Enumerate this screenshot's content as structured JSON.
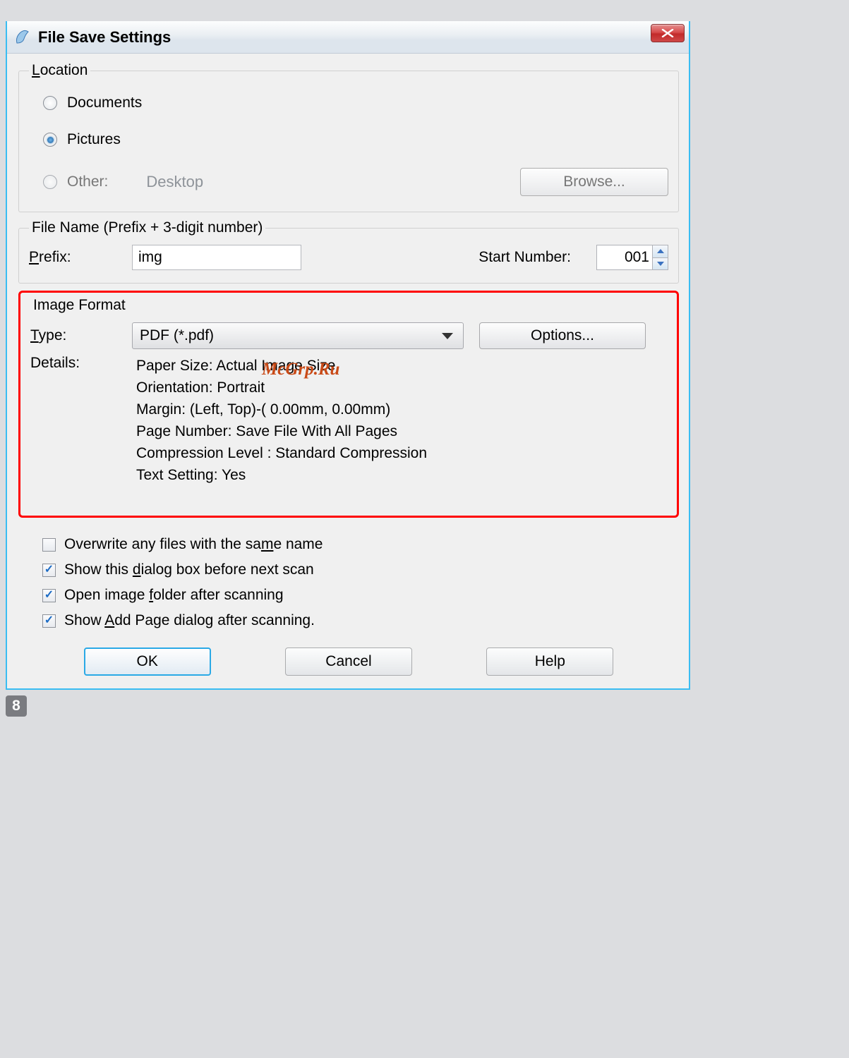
{
  "window": {
    "title": "File Save Settings"
  },
  "location": {
    "legend_pre": "L",
    "legend_rest": "ocation",
    "documents": "Documents",
    "pictures": "Pictures",
    "other": "Other:",
    "other_value": "Desktop",
    "browse_pre": "B",
    "browse_rest": "rowse..."
  },
  "filename": {
    "legend": "File Name (Prefix + 3-digit number)",
    "prefix_pre": "P",
    "prefix_rest": "refix:",
    "prefix_value": "img",
    "start_pre": "Start ",
    "start_ul": "N",
    "start_post": "umber:",
    "start_value": "001"
  },
  "image_format": {
    "legend": "Image Format",
    "type_pre": "T",
    "type_rest": "ype:",
    "type_value": "PDF (*.pdf)",
    "options_pre": "O",
    "options_rest": "ptions...",
    "details_label": "Details:",
    "details": {
      "l1": "Paper Size: Actual Image Size",
      "l2": "Orientation: Portrait",
      "l3": "Margin: (Left, Top)-( 0.00mm, 0.00mm)",
      "l4": "Page Number: Save File With All Pages",
      "l5": "Compression Level : Standard Compression",
      "l6": "Text Setting: Yes"
    },
    "watermark": "McGrp.Ru"
  },
  "checks": {
    "c1_pre": "Overwrite any files with the sa",
    "c1_ul": "m",
    "c1_post": "e name",
    "c2_pre": "Show this ",
    "c2_ul": "d",
    "c2_post": "ialog box before next scan",
    "c3_pre": "Open image ",
    "c3_ul": "f",
    "c3_post": "older after scanning",
    "c4_pre": "Show ",
    "c4_ul": "A",
    "c4_post": "dd Page dialog after scanning."
  },
  "buttons": {
    "ok": "OK",
    "cancel": "Cancel",
    "help_pre": "H",
    "help_rest": "elp"
  },
  "page_number": "8"
}
